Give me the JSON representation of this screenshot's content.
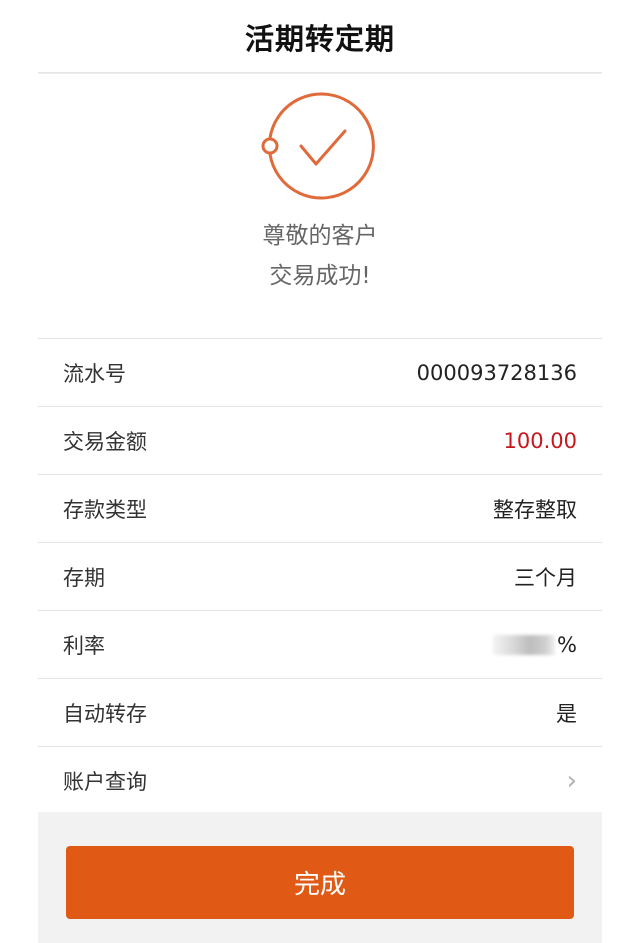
{
  "header": {
    "title": "活期转定期"
  },
  "result": {
    "line1": "尊敬的客户",
    "line2": "交易成功!"
  },
  "details": {
    "serial": {
      "label": "流水号",
      "value": "000093728136"
    },
    "amount": {
      "label": "交易金额",
      "value": "100.00"
    },
    "deposit_type": {
      "label": "存款类型",
      "value": "整存整取"
    },
    "term": {
      "label": "存期",
      "value": "三个月"
    },
    "rate": {
      "label": "利率",
      "suffix": "%"
    },
    "auto_renew": {
      "label": "自动转存",
      "value": "是"
    },
    "account_query": {
      "label": "账户查询",
      "chevron": "›"
    }
  },
  "actions": {
    "done_label": "完成"
  },
  "colors": {
    "accent": "#e05a16",
    "amount": "#c8161d",
    "icon": "#e06a3a"
  },
  "icons": {
    "success": "check-circle-icon"
  }
}
